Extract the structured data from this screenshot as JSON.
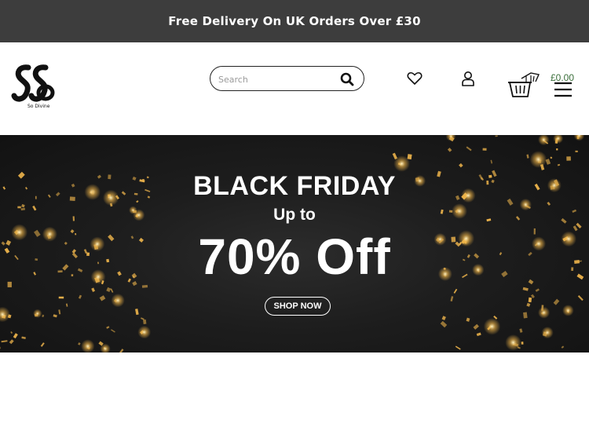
{
  "promo": {
    "text": "Free Delivery On UK Orders Over £30"
  },
  "logo": {
    "caption": "So Divine"
  },
  "search": {
    "placeholder": "Search"
  },
  "cart": {
    "total": "£0.00"
  },
  "hero": {
    "title": "BLACK FRIDAY",
    "subtitle": "Up to",
    "offer": "70% Off",
    "cta": "SHOP NOW"
  },
  "icons": {
    "search": "search-icon",
    "wishlist": "heart-icon",
    "account": "user-icon",
    "cart": "basket-icon",
    "menu": "hamburger-menu-icon"
  },
  "colors": {
    "promo_bar": "#3d3d3d",
    "hero_background": "#1d1d1d",
    "confetti_gold": "#e8b04a",
    "cart_total": "#3a6e3a"
  }
}
